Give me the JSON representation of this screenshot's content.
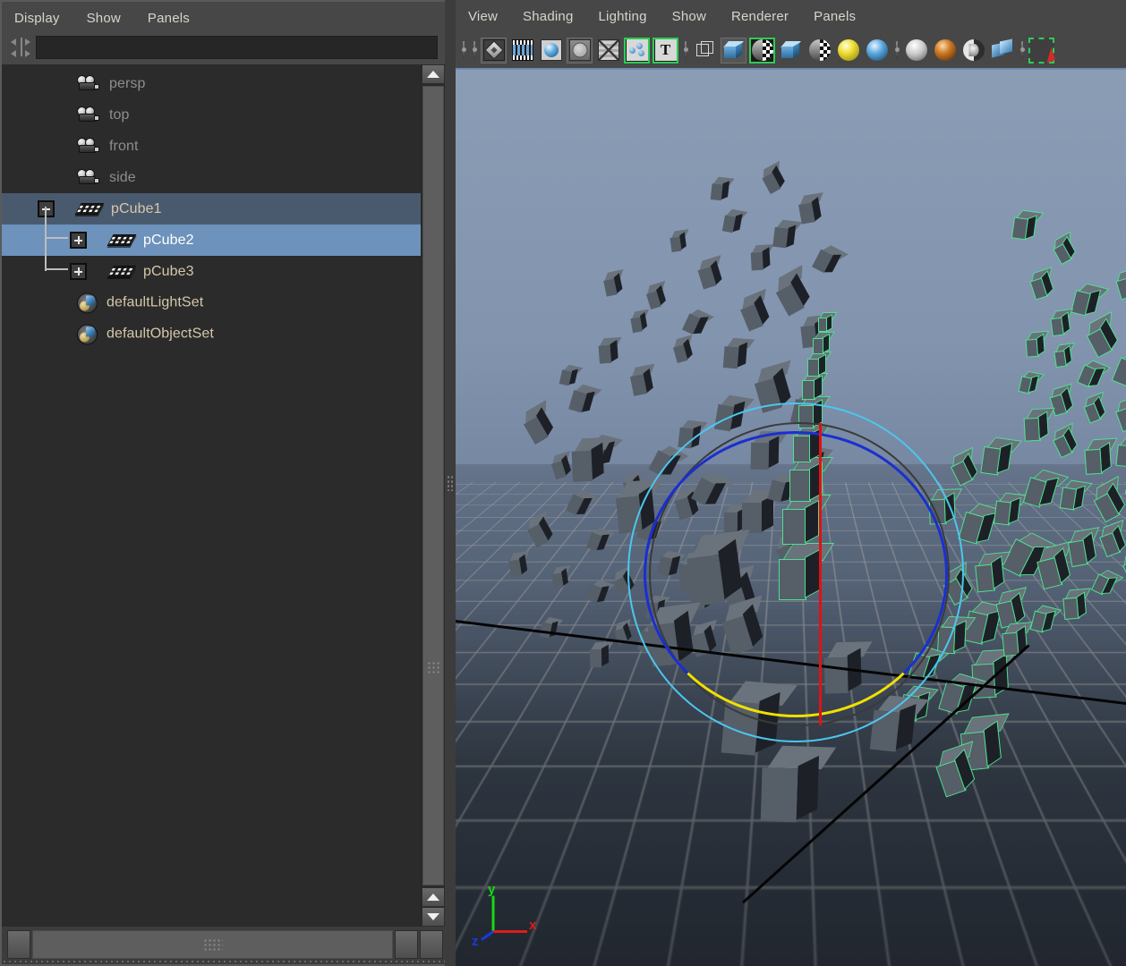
{
  "outliner": {
    "menus": [
      {
        "label": "Display",
        "name": "menu-display"
      },
      {
        "label": "Show",
        "name": "menu-show"
      },
      {
        "label": "Panels",
        "name": "menu-panels"
      }
    ],
    "search": {
      "value": "",
      "placeholder": ""
    },
    "rows": [
      {
        "label": "persp",
        "indent": 84,
        "icon": "camera-icon",
        "style": "dim",
        "expander": "none",
        "rowstate": "none"
      },
      {
        "label": "top",
        "indent": 84,
        "icon": "camera-icon",
        "style": "dim",
        "expander": "none",
        "rowstate": "none"
      },
      {
        "label": "front",
        "indent": 84,
        "icon": "camera-icon",
        "style": "dim",
        "expander": "none",
        "rowstate": "none"
      },
      {
        "label": "side",
        "indent": 84,
        "icon": "camera-icon",
        "style": "dim",
        "expander": "none",
        "rowstate": "none"
      },
      {
        "label": "pCube1",
        "indent": 84,
        "icon": "mesh-icon",
        "style": "normal",
        "expander": "minus",
        "rowstate": "selected-parent"
      },
      {
        "label": "pCube2",
        "indent": 120,
        "icon": "mesh-icon",
        "style": "bright",
        "expander": "plus",
        "rowstate": "selected"
      },
      {
        "label": "pCube3",
        "indent": 120,
        "icon": "mesh-icon",
        "style": "normal",
        "expander": "plus",
        "rowstate": "none"
      },
      {
        "label": "defaultLightSet",
        "indent": 84,
        "icon": "set-icon",
        "style": "normal",
        "expander": "none",
        "rowstate": "none"
      },
      {
        "label": "defaultObjectSet",
        "indent": 84,
        "icon": "set-icon",
        "style": "normal",
        "expander": "none",
        "rowstate": "none"
      }
    ]
  },
  "viewport_panel": {
    "menus": [
      {
        "label": "View",
        "name": "menu-view"
      },
      {
        "label": "Shading",
        "name": "menu-shading"
      },
      {
        "label": "Lighting",
        "name": "menu-lighting"
      },
      {
        "label": "Show",
        "name": "menu-show"
      },
      {
        "label": "Renderer",
        "name": "menu-renderer"
      },
      {
        "label": "Panels",
        "name": "menu-panels"
      }
    ],
    "toolbar": [
      {
        "kind": "sep",
        "name": "toolbar-separator"
      },
      {
        "kind": "sep",
        "name": "toolbar-separator"
      },
      {
        "kind": "icon",
        "name": "select-camera-icon",
        "glyph": "g-diamond",
        "box": "framed"
      },
      {
        "kind": "icon",
        "name": "film-gate-icon",
        "glyph": "g-film",
        "box": "plain"
      },
      {
        "kind": "icon",
        "name": "resolution-gate-icon",
        "glyph": "g-sphereblue",
        "box": "plain"
      },
      {
        "kind": "icon",
        "name": "gate-mask-icon",
        "glyph": "g-circlegray",
        "box": "framed"
      },
      {
        "kind": "icon",
        "name": "xray-joints-icon",
        "glyph": "g-wiremesh",
        "box": "plain"
      },
      {
        "kind": "icon",
        "name": "show-particles-icon",
        "glyph": "g-particles",
        "box": "active-green"
      },
      {
        "kind": "icon",
        "name": "show-text-icon",
        "glyph": "g-T",
        "box": "active-green"
      },
      {
        "kind": "sep",
        "name": "toolbar-separator"
      },
      {
        "kind": "icon",
        "name": "wireframe-shading-icon",
        "glyph": "g-cube-wire",
        "box": "plain"
      },
      {
        "kind": "icon",
        "name": "smooth-shade-all-icon",
        "glyph": "g-cube-solid",
        "box": "framed"
      },
      {
        "kind": "icon",
        "name": "smooth-shade-wire-icon",
        "glyph": "g-halfcheck",
        "box": "active-green"
      },
      {
        "kind": "icon",
        "name": "flat-shade-icon",
        "glyph": "g-cube-solid",
        "box": "plain"
      },
      {
        "kind": "icon",
        "name": "shade-options-icon",
        "glyph": "g-halfcheck",
        "box": "plain"
      },
      {
        "kind": "icon",
        "name": "use-default-light-icon",
        "glyph": "g-ball-yellow",
        "box": "plain"
      },
      {
        "kind": "icon",
        "name": "use-all-lights-icon",
        "glyph": "g-ball-blue",
        "box": "plain"
      },
      {
        "kind": "sep",
        "name": "toolbar-separator"
      },
      {
        "kind": "icon",
        "name": "shadows-icon",
        "glyph": "g-ball-silver",
        "box": "plain"
      },
      {
        "kind": "icon",
        "name": "texture-icon",
        "glyph": "g-ball-copper",
        "box": "plain"
      },
      {
        "kind": "icon",
        "name": "hardware-fog-icon",
        "glyph": "g-ball-split",
        "box": "plain"
      },
      {
        "kind": "icon",
        "name": "isolate-select-icon",
        "glyph": "g-cubes-blue",
        "box": "plain"
      },
      {
        "kind": "sep",
        "name": "toolbar-separator"
      },
      {
        "kind": "icon",
        "name": "selection-marquee-icon",
        "glyph": "g-selcursor",
        "box": "active-dash"
      }
    ],
    "axis_gizmo": {
      "x_label": "x",
      "y_label": "y",
      "z_label": "z",
      "x_color": "#e01b1b",
      "y_color": "#16d916",
      "z_color": "#1b38e0"
    },
    "manipulator": {
      "outer_ring_color": "#4cc6ef",
      "view_ring_color": "#3a3a3a",
      "x_arc_color": "#1a2fd0",
      "z_arc_color": "#f0e000",
      "y_axis_color": "#e01212"
    },
    "scene": {
      "selected_outline_color": "#4fe08f",
      "cube_fill_color": "#555d66",
      "grid_color": "#cdcdcd",
      "axis_color": "#050505",
      "background_top": "#8b9db5",
      "background_bottom": "#2e353f"
    }
  },
  "scrollbars": {
    "up_arrow": "▲",
    "down_arrow": "▼",
    "left_arrow": "◀",
    "right_arrow": "▶"
  }
}
